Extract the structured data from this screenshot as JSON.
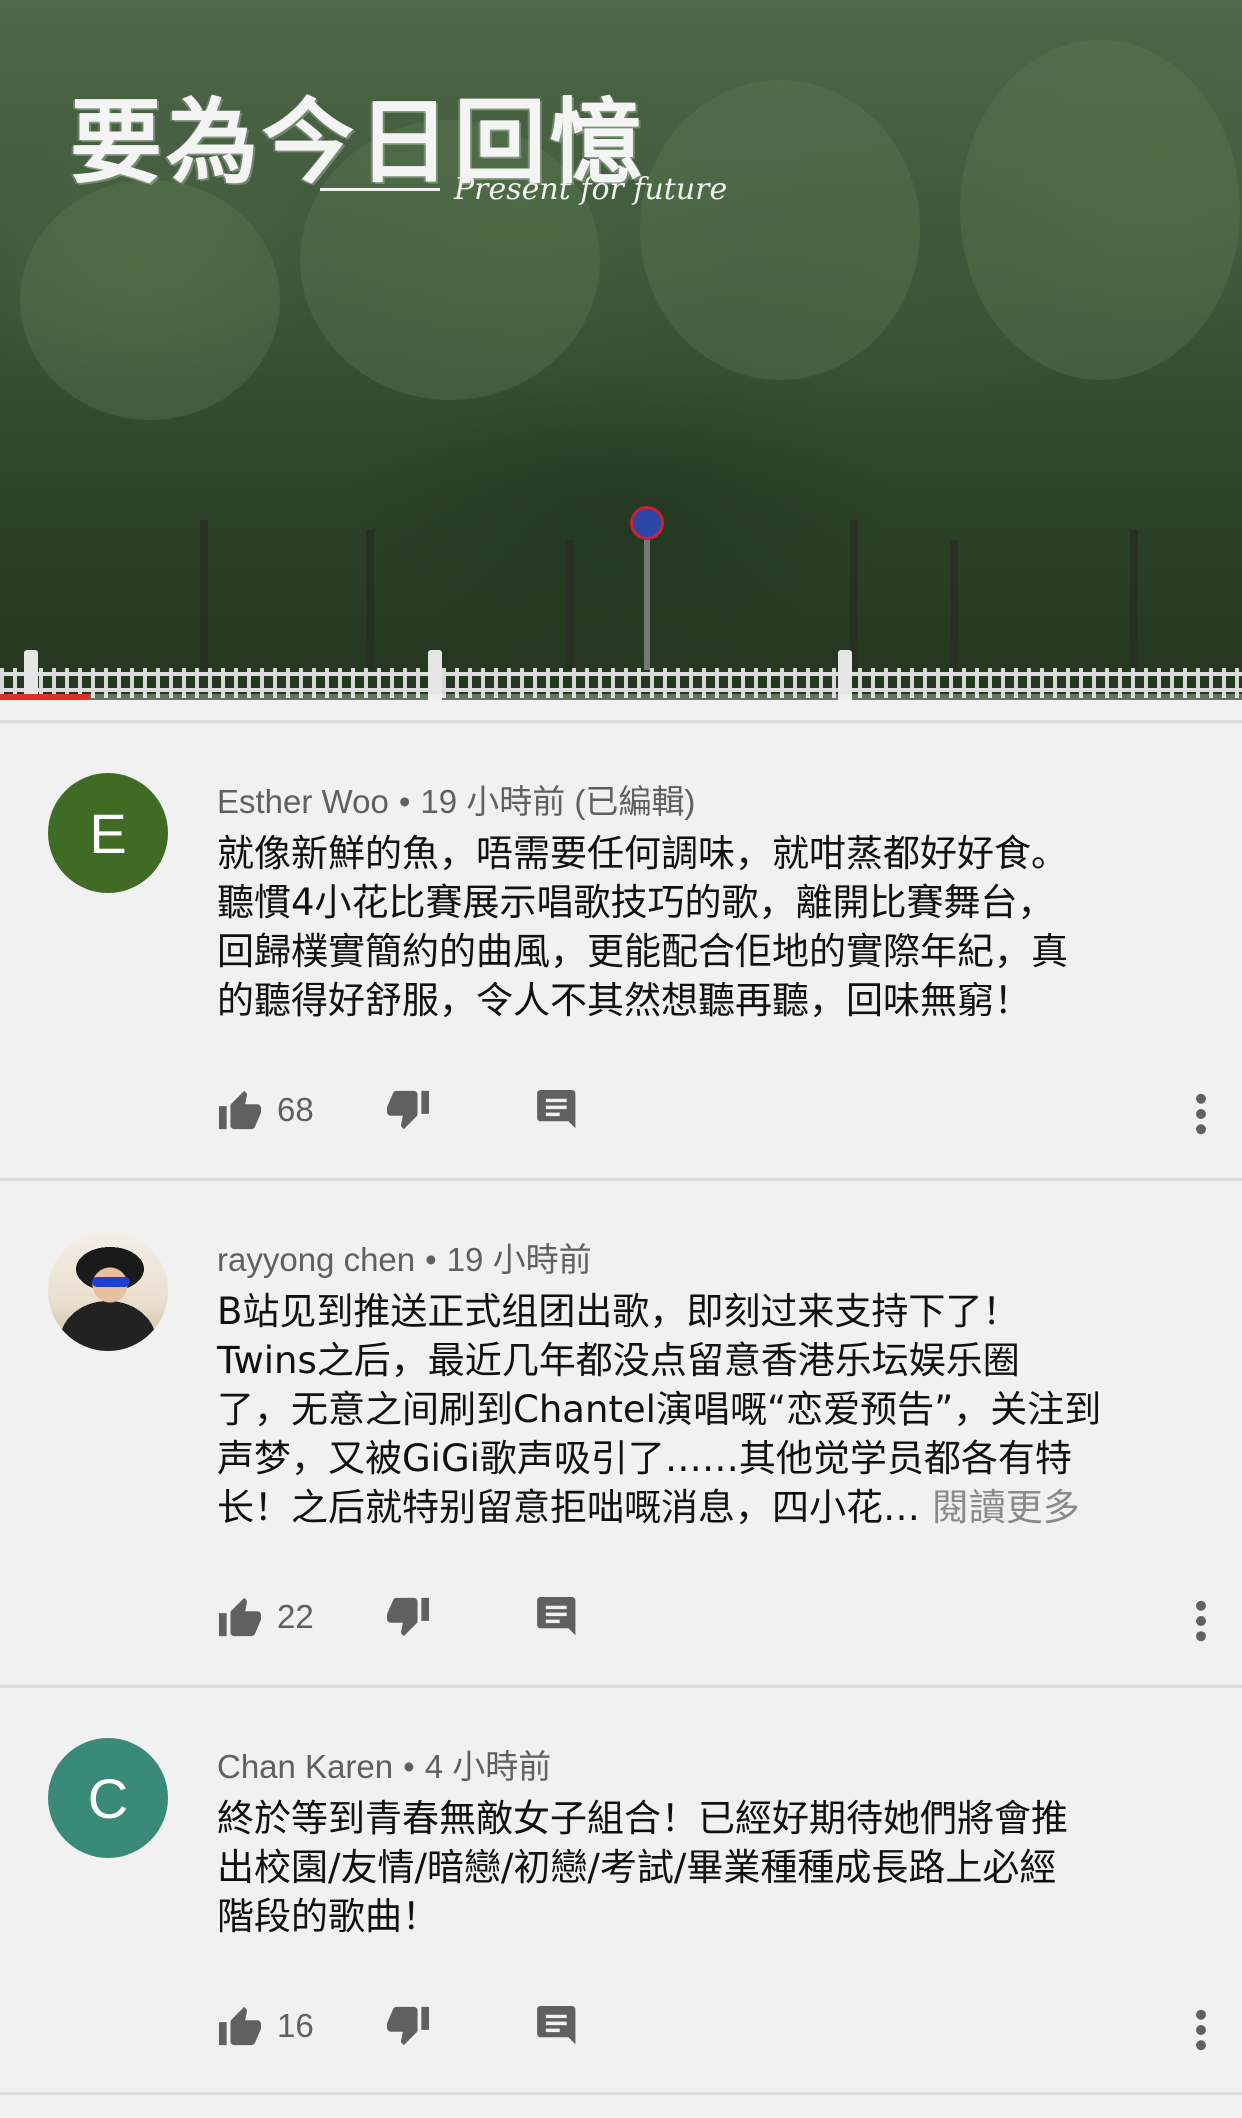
{
  "video": {
    "logo_title": "要為今日回憶",
    "logo_subtitle": "Present for future",
    "progress": 0.072,
    "progress_color": "#e52d27"
  },
  "comments": [
    {
      "avatar_letter": "E",
      "avatar_color": "#3f6b25",
      "author": "Esther Woo",
      "time": "19 小時前 (已編輯)",
      "lines": [
        "就像新鮮的魚，唔需要任何調味，就咁蒸都好好食。",
        "聽慣4小花比賽展示唱歌技巧的歌，離開比賽舞台，",
        "回歸樸實簡約的曲風，更能配合佢地的實際年紀，真",
        "的聽得好舒服，令人不其然想聽再聽，回味無窮！"
      ],
      "likes": "68"
    },
    {
      "avatar_type": "photo",
      "author": "rayyong chen",
      "time": "19 小時前",
      "lines": [
        "B站见到推送正式组团出歌，即刻过来支持下了！",
        "Twins之后，最近几年都没点留意香港乐坛娱乐圈",
        "了，无意之间刷到Chantel演唱嘅“恋爱预告”，关注到",
        "声梦，又被GiGi歌声吸引了……其他觉学员都各有特",
        "长！之后就特别留意拒咄嘅消息，四小花…"
      ],
      "read_more": "閱讀更多",
      "likes": "22"
    },
    {
      "avatar_letter": "C",
      "avatar_color": "#3a8a7a",
      "author": "Chan Karen",
      "time": "4 小時前",
      "lines": [
        "終於等到青春無敵女子組合！已經好期待她們將會推",
        "出校園/友情/暗戀/初戀/考試/畢業種種成長路上必經",
        "階段的歌曲！"
      ],
      "likes": "16"
    }
  ],
  "icons": {
    "like": "thumbs-up-icon",
    "dislike": "thumbs-down-icon",
    "reply": "comment-icon",
    "more": "more-vertical-icon"
  }
}
